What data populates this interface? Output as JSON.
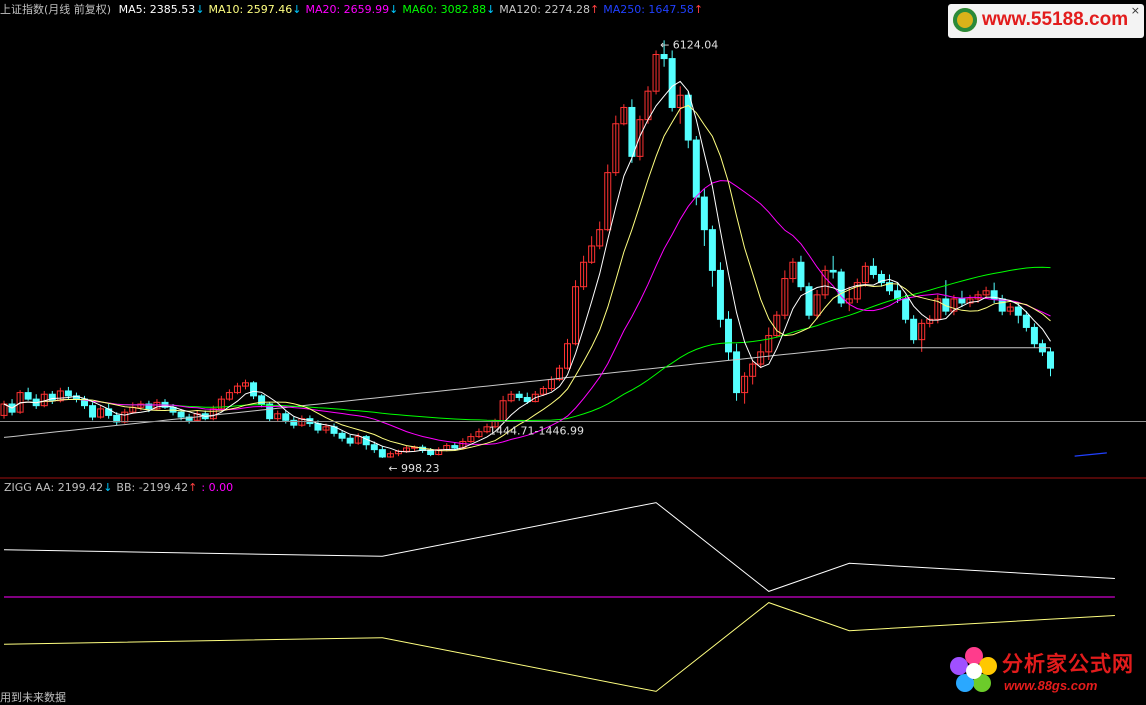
{
  "main_legend": {
    "title": "上证指数(月线 前复权)",
    "items": [
      {
        "label": "MA5: 2385.53",
        "arrow": "↓",
        "arrow_dir": "down",
        "color": "#ffffff"
      },
      {
        "label": "MA10: 2597.46",
        "arrow": "↓",
        "arrow_dir": "down",
        "color": "#ffff80"
      },
      {
        "label": "MA20: 2659.99",
        "arrow": "↓",
        "arrow_dir": "down",
        "color": "#ff00ff"
      },
      {
        "label": "MA60: 3082.88",
        "arrow": "↓",
        "arrow_dir": "down",
        "color": "#00ff00"
      },
      {
        "label": "MA120: 2274.28",
        "arrow": "↑",
        "arrow_dir": "up",
        "color": "#c8c8c8"
      },
      {
        "label": "MA250: 1647.58",
        "arrow": "↑",
        "arrow_dir": "up",
        "color": "#2040ff"
      }
    ]
  },
  "indicator_legend": {
    "items": [
      {
        "label": "ZIGG  AA: 2199.42",
        "arrow": "↓",
        "arrow_dir": "down",
        "color": "#c0c0c0"
      },
      {
        "label": "BB: -2199.42",
        "arrow": "↑",
        "arrow_dir": "up",
        "color": "#c0c0c0"
      },
      {
        "label": ": 0.00",
        "arrow": "",
        "arrow_dir": "",
        "color": "#ff00ff"
      }
    ]
  },
  "footer": {
    "text": "用到未来数据"
  },
  "logos": {
    "top_right": {
      "text": "www.55188.com",
      "close": "×"
    },
    "bottom_right": {
      "line1": "分析家公式网",
      "line2": "www.88gs.com"
    }
  },
  "colors": {
    "up_candle": "#ff3232",
    "down_candle": "#54ffff",
    "ma5": "#ffffff",
    "ma10": "#ffff80",
    "ma20": "#ff00ff",
    "ma60": "#00ff00",
    "ma120": "#c8c8c8",
    "ma250": "#2040ff",
    "divider": "#a01010",
    "indicator_aa": "#ffffff",
    "indicator_bb": "#ffff80",
    "zero_line": "#ff00ff"
  },
  "chart_data": [
    {
      "type": "candlestick",
      "title": "上证指数(月线 前复权)",
      "price_range": [
        850,
        6300
      ],
      "annotations": [
        {
          "text": "6124.04",
          "price": 6124.04
        },
        {
          "text": "998.23",
          "price": 998.23
        },
        {
          "text": "1444.71-1446.99",
          "price": 1446
        }
      ],
      "candles": [
        [
          1520,
          1660,
          1700,
          1480
        ],
        [
          1660,
          1560,
          1720,
          1520
        ],
        [
          1560,
          1800,
          1830,
          1540
        ],
        [
          1800,
          1720,
          1860,
          1700
        ],
        [
          1720,
          1640,
          1780,
          1600
        ],
        [
          1640,
          1780,
          1820,
          1620
        ],
        [
          1780,
          1700,
          1820,
          1660
        ],
        [
          1700,
          1820,
          1860,
          1680
        ],
        [
          1820,
          1760,
          1870,
          1720
        ],
        [
          1760,
          1720,
          1800,
          1680
        ],
        [
          1720,
          1640,
          1760,
          1600
        ],
        [
          1640,
          1500,
          1680,
          1460
        ],
        [
          1500,
          1600,
          1640,
          1480
        ],
        [
          1600,
          1520,
          1660,
          1480
        ],
        [
          1520,
          1440,
          1560,
          1400
        ],
        [
          1440,
          1560,
          1600,
          1420
        ],
        [
          1560,
          1620,
          1680,
          1540
        ],
        [
          1620,
          1660,
          1700,
          1580
        ],
        [
          1660,
          1600,
          1700,
          1560
        ],
        [
          1600,
          1680,
          1720,
          1580
        ],
        [
          1680,
          1620,
          1720,
          1600
        ],
        [
          1620,
          1560,
          1660,
          1520
        ],
        [
          1560,
          1500,
          1600,
          1460
        ],
        [
          1500,
          1460,
          1540,
          1420
        ],
        [
          1460,
          1540,
          1580,
          1440
        ],
        [
          1540,
          1480,
          1580,
          1460
        ],
        [
          1480,
          1600,
          1640,
          1460
        ],
        [
          1600,
          1720,
          1760,
          1580
        ],
        [
          1720,
          1800,
          1840,
          1700
        ],
        [
          1800,
          1880,
          1920,
          1780
        ],
        [
          1880,
          1920,
          1960,
          1840
        ],
        [
          1920,
          1760,
          1940,
          1720
        ],
        [
          1760,
          1660,
          1780,
          1620
        ],
        [
          1660,
          1480,
          1680,
          1440
        ],
        [
          1480,
          1540,
          1580,
          1440
        ],
        [
          1540,
          1460,
          1580,
          1420
        ],
        [
          1460,
          1400,
          1500,
          1360
        ],
        [
          1400,
          1480,
          1520,
          1380
        ],
        [
          1480,
          1420,
          1520,
          1380
        ],
        [
          1420,
          1340,
          1460,
          1300
        ],
        [
          1340,
          1380,
          1420,
          1300
        ],
        [
          1380,
          1300,
          1420,
          1260
        ],
        [
          1300,
          1240,
          1340,
          1200
        ],
        [
          1240,
          1180,
          1280,
          1140
        ],
        [
          1180,
          1260,
          1300,
          1160
        ],
        [
          1260,
          1160,
          1280,
          1100
        ],
        [
          1160,
          1100,
          1200,
          1060
        ],
        [
          1100,
          1010,
          1140,
          998
        ],
        [
          1010,
          1050,
          1080,
          1000
        ],
        [
          1050,
          1080,
          1100,
          1020
        ],
        [
          1080,
          1120,
          1150,
          1060
        ],
        [
          1120,
          1130,
          1150,
          1080
        ],
        [
          1130,
          1090,
          1160,
          1060
        ],
        [
          1090,
          1040,
          1120,
          1020
        ],
        [
          1040,
          1100,
          1130,
          1030
        ],
        [
          1100,
          1150,
          1180,
          1080
        ],
        [
          1150,
          1120,
          1180,
          1100
        ],
        [
          1120,
          1200,
          1240,
          1100
        ],
        [
          1200,
          1260,
          1300,
          1180
        ],
        [
          1260,
          1320,
          1360,
          1240
        ],
        [
          1320,
          1380,
          1420,
          1300
        ],
        [
          1380,
          1450,
          1480,
          1360
        ],
        [
          1450,
          1700,
          1760,
          1440
        ],
        [
          1700,
          1780,
          1820,
          1680
        ],
        [
          1780,
          1740,
          1820,
          1700
        ],
        [
          1740,
          1690,
          1800,
          1660
        ],
        [
          1690,
          1780,
          1820,
          1680
        ],
        [
          1780,
          1850,
          1880,
          1760
        ],
        [
          1850,
          1960,
          2000,
          1820
        ],
        [
          1960,
          2100,
          2140,
          1940
        ],
        [
          2100,
          2400,
          2460,
          2080
        ],
        [
          2400,
          3100,
          3180,
          2380
        ],
        [
          3100,
          3400,
          3480,
          3060
        ],
        [
          3400,
          3600,
          3720,
          3380
        ],
        [
          3600,
          3800,
          3900,
          3560
        ],
        [
          3800,
          4500,
          4600,
          3780
        ],
        [
          4500,
          5100,
          5200,
          4460
        ],
        [
          5100,
          5300,
          5340,
          5080
        ],
        [
          5300,
          4700,
          5400,
          4620
        ],
        [
          4700,
          5150,
          5200,
          4650
        ],
        [
          5150,
          5500,
          5560,
          5100
        ],
        [
          5500,
          5950,
          6000,
          5460
        ],
        [
          5950,
          5900,
          6124,
          5800
        ],
        [
          5900,
          5300,
          6000,
          5250
        ],
        [
          5300,
          5450,
          5560,
          5100
        ],
        [
          5450,
          4900,
          5500,
          4800
        ],
        [
          4900,
          4200,
          4950,
          4100
        ],
        [
          4200,
          3800,
          4300,
          3600
        ],
        [
          3800,
          3300,
          3850,
          3100
        ],
        [
          3300,
          2700,
          3400,
          2600
        ],
        [
          2700,
          2300,
          2800,
          2200
        ],
        [
          2300,
          1800,
          2400,
          1700
        ],
        [
          1800,
          2000,
          2050,
          1664
        ],
        [
          2000,
          2150,
          2200,
          1900
        ],
        [
          2150,
          2300,
          2400,
          2100
        ],
        [
          2300,
          2500,
          2600,
          2200
        ],
        [
          2500,
          2750,
          2800,
          2480
        ],
        [
          2750,
          3200,
          3300,
          2700
        ],
        [
          3200,
          3400,
          3450,
          3150
        ],
        [
          3400,
          3100,
          3480,
          3050
        ],
        [
          3100,
          2750,
          3150,
          2700
        ],
        [
          2750,
          3000,
          3060,
          2700
        ],
        [
          3000,
          3300,
          3360,
          2950
        ],
        [
          3300,
          3280,
          3478,
          3200
        ],
        [
          3280,
          2900,
          3320,
          2850
        ],
        [
          2900,
          2950,
          3100,
          2800
        ],
        [
          2950,
          3150,
          3200,
          2900
        ],
        [
          3150,
          3350,
          3400,
          3100
        ],
        [
          3350,
          3250,
          3450,
          3200
        ],
        [
          3250,
          3150,
          3300,
          3100
        ],
        [
          3150,
          3050,
          3250,
          3000
        ],
        [
          3050,
          2950,
          3150,
          2900
        ],
        [
          2950,
          2700,
          3000,
          2650
        ],
        [
          2700,
          2450,
          2750,
          2400
        ],
        [
          2450,
          2650,
          2700,
          2300
        ],
        [
          2650,
          2700,
          2750,
          2600
        ],
        [
          2700,
          2950,
          3000,
          2650
        ],
        [
          2950,
          2800,
          3180,
          2750
        ],
        [
          2800,
          2950,
          3000,
          2750
        ],
        [
          2950,
          2900,
          3050,
          2850
        ],
        [
          2900,
          2950,
          3000,
          2850
        ],
        [
          2950,
          3000,
          3050,
          2900
        ],
        [
          3000,
          3050,
          3100,
          2950
        ],
        [
          3050,
          2950,
          3150,
          2900
        ],
        [
          2950,
          2800,
          3000,
          2750
        ],
        [
          2800,
          2850,
          2900,
          2750
        ],
        [
          2850,
          2750,
          2900,
          2650
        ],
        [
          2750,
          2600,
          2800,
          2550
        ],
        [
          2600,
          2400,
          2650,
          2350
        ],
        [
          2400,
          2300,
          2450,
          2250
        ],
        [
          2300,
          2100,
          2350,
          2000
        ]
      ]
    },
    {
      "type": "line",
      "title": "ZIGG",
      "series": [
        {
          "name": "AA",
          "values_anchors": [
            [
              0,
              2550
            ],
            [
              47,
              2200
            ],
            [
              81,
              5100
            ],
            [
              95,
              300
            ],
            [
              105,
              1820
            ],
            [
              138,
              1000
            ]
          ]
        },
        {
          "name": "BB",
          "values_anchors": [
            [
              0,
              -2550
            ],
            [
              47,
              -2200
            ],
            [
              81,
              -5100
            ],
            [
              95,
              -300
            ],
            [
              105,
              -1820
            ],
            [
              138,
              -1000
            ]
          ]
        }
      ],
      "zero_line": 0
    }
  ]
}
